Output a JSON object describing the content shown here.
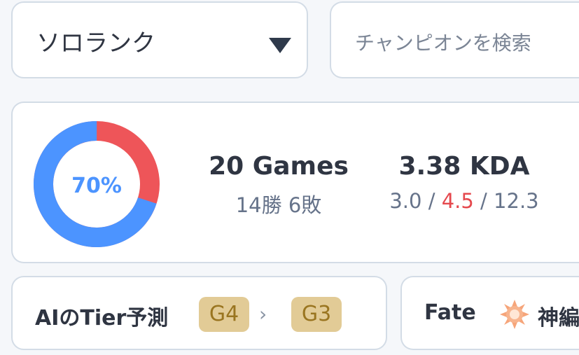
{
  "queue": {
    "selected": "ソロランク",
    "caret_icon": "caret-down-icon"
  },
  "search": {
    "placeholder": "チャンピオンを検索"
  },
  "stats": {
    "winrate_label": "70%",
    "winrate": 0.7,
    "win_color": "#4c94ff",
    "loss_color": "#ee5559",
    "games_label": "20 Games",
    "record": "14勝 6敗",
    "kda_label": "3.38 KDA",
    "kills": "3.0",
    "deaths": "4.5",
    "assists": "12.3",
    "separator": "/"
  },
  "tier": {
    "title": "AIのTier予測",
    "current": "G4",
    "predicted": "G3",
    "arrow_icon": "chevron-right-icon"
  },
  "fate": {
    "title": "Fate",
    "icon": "sun-icon",
    "value": "神編"
  }
}
